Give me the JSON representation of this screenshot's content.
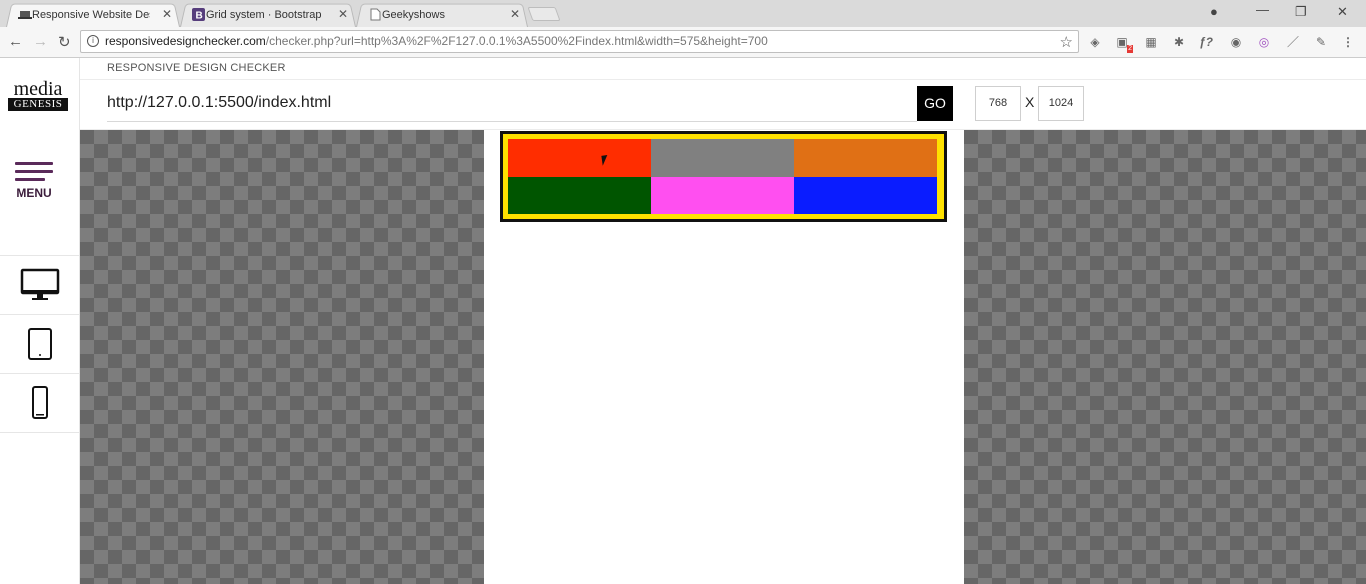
{
  "browser": {
    "tabs": [
      {
        "title": "Responsive Website Des",
        "favicon": "laptop-icon",
        "active": true
      },
      {
        "title": "Grid system · Bootstrap",
        "favicon": "bootstrap-b-icon",
        "active": false
      },
      {
        "title": "Geekyshows",
        "favicon": "page-icon",
        "active": false
      }
    ],
    "url_host": "responsivedesignchecker.com",
    "url_path": "/checker.php?url=http%3A%2F%2F127.0.0.1%3A5500%2Findex.html&width=575&height=700",
    "extension_badge": "2"
  },
  "app": {
    "logo_top": "media",
    "logo_bottom": "GENESIS",
    "menu_label": "MENU",
    "title": "RESPONSIVE DESIGN CHECKER",
    "url_value": "http://127.0.0.1:5500/index.html",
    "go_label": "GO",
    "width": "768",
    "x_sep": "X",
    "height": "1024",
    "devices": [
      "desktop-icon",
      "tablet-icon",
      "phone-icon"
    ]
  },
  "preview": {
    "cells": [
      {
        "color": "#ff2d00"
      },
      {
        "color": "#808080"
      },
      {
        "color": "#e07015"
      },
      {
        "color": "#005500"
      },
      {
        "color": "#ff4ff0"
      },
      {
        "color": "#0a1cff"
      }
    ],
    "border_color": "#ffe100"
  }
}
